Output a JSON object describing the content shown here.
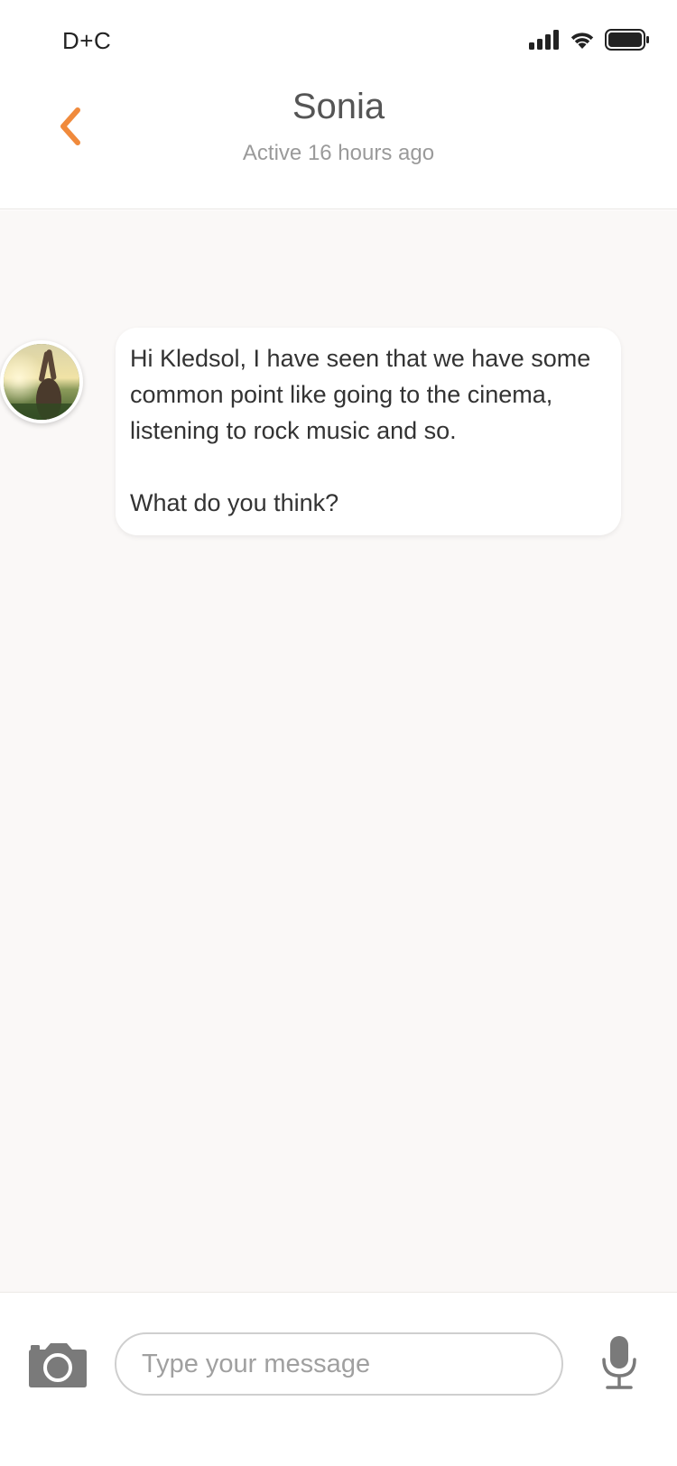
{
  "status_bar": {
    "carrier": "D+C",
    "icons": [
      "signal-icon",
      "wifi-icon",
      "battery-icon"
    ]
  },
  "header": {
    "back_icon": "chevron-left-icon",
    "contact_name": "Sonia",
    "contact_status": "Active 16 hours ago"
  },
  "conversation": {
    "messages": [
      {
        "sender": "Sonia",
        "paragraphs": [
          "Hi Kledsol, I have seen that we have some common point like going to the cinema, listening to rock music and so.",
          "What do you think?"
        ]
      }
    ]
  },
  "composer": {
    "camera_icon": "camera-icon",
    "placeholder": "Type your message",
    "mic_icon": "microphone-icon"
  },
  "colors": {
    "accent": "#f08a3c",
    "chat_background": "#faf8f7",
    "text_primary": "#333333",
    "text_secondary": "#9a9a9a",
    "icon_gray": "#7a7a7a"
  }
}
